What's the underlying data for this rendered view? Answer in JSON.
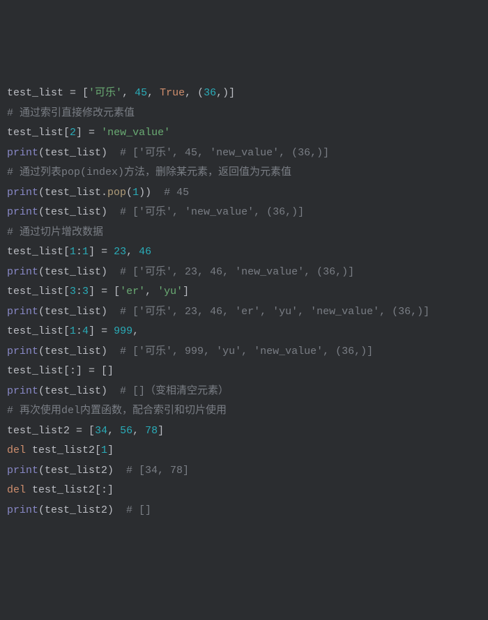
{
  "lines": [
    [
      {
        "t": "test_list ",
        "c": "var"
      },
      {
        "t": "=",
        "c": "op"
      },
      {
        "t": " [",
        "c": "punc"
      },
      {
        "t": "'可乐'",
        "c": "str"
      },
      {
        "t": ", ",
        "c": "punc"
      },
      {
        "t": "45",
        "c": "num"
      },
      {
        "t": ", ",
        "c": "punc"
      },
      {
        "t": "True",
        "c": "kw-const"
      },
      {
        "t": ", (",
        "c": "punc"
      },
      {
        "t": "36",
        "c": "num"
      },
      {
        "t": ",)]",
        "c": "punc"
      }
    ],
    [
      {
        "t": "# 通过索引直接修改元素值",
        "c": "comment"
      }
    ],
    [
      {
        "t": "test_list[",
        "c": "var"
      },
      {
        "t": "2",
        "c": "num"
      },
      {
        "t": "] ",
        "c": "punc"
      },
      {
        "t": "=",
        "c": "op"
      },
      {
        "t": " ",
        "c": "punc"
      },
      {
        "t": "'new_value'",
        "c": "str"
      }
    ],
    [
      {
        "t": "print",
        "c": "builtin"
      },
      {
        "t": "(test_list)  ",
        "c": "punc"
      },
      {
        "t": "# ['可乐', 45, 'new_value', (36,)]",
        "c": "comment"
      }
    ],
    [
      {
        "t": "# 通过列表pop(index)方法，删除某元素，返回值为元素值",
        "c": "comment"
      }
    ],
    [
      {
        "t": "print",
        "c": "builtin"
      },
      {
        "t": "(test_list.",
        "c": "punc"
      },
      {
        "t": "pop",
        "c": "method"
      },
      {
        "t": "(",
        "c": "punc"
      },
      {
        "t": "1",
        "c": "num"
      },
      {
        "t": "))  ",
        "c": "punc"
      },
      {
        "t": "# 45",
        "c": "comment"
      }
    ],
    [
      {
        "t": "print",
        "c": "builtin"
      },
      {
        "t": "(test_list)  ",
        "c": "punc"
      },
      {
        "t": "# ['可乐', 'new_value', (36,)]",
        "c": "comment"
      }
    ],
    [
      {
        "t": "# 通过切片增改数据",
        "c": "comment"
      }
    ],
    [
      {
        "t": "test_list[",
        "c": "var"
      },
      {
        "t": "1",
        "c": "num"
      },
      {
        "t": ":",
        "c": "punc"
      },
      {
        "t": "1",
        "c": "num"
      },
      {
        "t": "] ",
        "c": "punc"
      },
      {
        "t": "=",
        "c": "op"
      },
      {
        "t": " ",
        "c": "punc"
      },
      {
        "t": "23",
        "c": "num"
      },
      {
        "t": ", ",
        "c": "punc"
      },
      {
        "t": "46",
        "c": "num"
      }
    ],
    [
      {
        "t": "print",
        "c": "builtin"
      },
      {
        "t": "(test_list)  ",
        "c": "punc"
      },
      {
        "t": "# ['可乐', 23, 46, 'new_value', (36,)]",
        "c": "comment"
      }
    ],
    [
      {
        "t": "test_list[",
        "c": "var"
      },
      {
        "t": "3",
        "c": "num"
      },
      {
        "t": ":",
        "c": "punc"
      },
      {
        "t": "3",
        "c": "num"
      },
      {
        "t": "] ",
        "c": "punc"
      },
      {
        "t": "=",
        "c": "op"
      },
      {
        "t": " [",
        "c": "punc"
      },
      {
        "t": "'er'",
        "c": "str"
      },
      {
        "t": ", ",
        "c": "punc"
      },
      {
        "t": "'yu'",
        "c": "str"
      },
      {
        "t": "]",
        "c": "punc"
      }
    ],
    [
      {
        "t": "print",
        "c": "builtin"
      },
      {
        "t": "(test_list)  ",
        "c": "punc"
      },
      {
        "t": "# ['可乐', 23, 46, 'er', 'yu', 'new_value', (36,)]",
        "c": "comment"
      }
    ],
    [
      {
        "t": "test_list[",
        "c": "var"
      },
      {
        "t": "1",
        "c": "num"
      },
      {
        "t": ":",
        "c": "punc"
      },
      {
        "t": "4",
        "c": "num"
      },
      {
        "t": "] ",
        "c": "punc"
      },
      {
        "t": "=",
        "c": "op"
      },
      {
        "t": " ",
        "c": "punc"
      },
      {
        "t": "999",
        "c": "num"
      },
      {
        "t": ",",
        "c": "punc"
      }
    ],
    [
      {
        "t": "print",
        "c": "builtin"
      },
      {
        "t": "(test_list)  ",
        "c": "punc"
      },
      {
        "t": "# ['可乐', 999, 'yu', 'new_value', (36,)]",
        "c": "comment"
      }
    ],
    [
      {
        "t": "test_list[:] ",
        "c": "var"
      },
      {
        "t": "=",
        "c": "op"
      },
      {
        "t": " []",
        "c": "punc"
      }
    ],
    [
      {
        "t": "print",
        "c": "builtin"
      },
      {
        "t": "(test_list)  ",
        "c": "punc"
      },
      {
        "t": "# []（变相清空元素）",
        "c": "comment"
      }
    ],
    [
      {
        "t": "# 再次使用del内置函数，配合索引和切片使用",
        "c": "comment"
      }
    ],
    [
      {
        "t": "test_list2 ",
        "c": "var"
      },
      {
        "t": "=",
        "c": "op"
      },
      {
        "t": " [",
        "c": "punc"
      },
      {
        "t": "34",
        "c": "num"
      },
      {
        "t": ", ",
        "c": "punc"
      },
      {
        "t": "56",
        "c": "num"
      },
      {
        "t": ", ",
        "c": "punc"
      },
      {
        "t": "78",
        "c": "num"
      },
      {
        "t": "]",
        "c": "punc"
      }
    ],
    [
      {
        "t": "del ",
        "c": "kw"
      },
      {
        "t": "test_list2[",
        "c": "var"
      },
      {
        "t": "1",
        "c": "num"
      },
      {
        "t": "]",
        "c": "punc"
      }
    ],
    [
      {
        "t": "print",
        "c": "builtin"
      },
      {
        "t": "(test_list2)  ",
        "c": "punc"
      },
      {
        "t": "# [34, 78]",
        "c": "comment"
      }
    ],
    [
      {
        "t": "del ",
        "c": "kw"
      },
      {
        "t": "test_list2[:]",
        "c": "var"
      }
    ],
    [
      {
        "t": "print",
        "c": "builtin"
      },
      {
        "t": "(test_list2)  ",
        "c": "punc"
      },
      {
        "t": "# []",
        "c": "comment"
      }
    ]
  ]
}
